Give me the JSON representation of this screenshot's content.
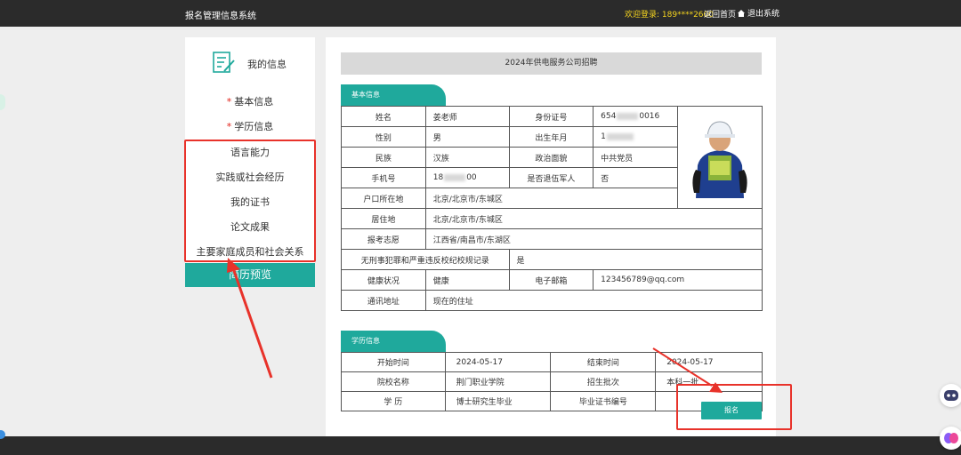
{
  "header": {
    "system_title": "报名管理信息系统",
    "welcome": "欢迎登录: 189****2600",
    "home_link": "返回首页",
    "logout": "退出系统"
  },
  "sidebar": {
    "title": "我的信息",
    "items": [
      {
        "label": "基本信息",
        "required": true
      },
      {
        "label": "学历信息",
        "required": true
      },
      {
        "label": "语言能力",
        "required": false
      },
      {
        "label": "实践或社会经历",
        "required": false
      },
      {
        "label": "我的证书",
        "required": false
      },
      {
        "label": "论文成果",
        "required": false
      },
      {
        "label": "主要家庭成员和社会关系",
        "required": false
      }
    ],
    "preview_button": "简历预览"
  },
  "main": {
    "job_title": "2024年供电服务公司招聘",
    "basic_tab": "基本信息",
    "basic": {
      "name_label": "姓名",
      "name": "姜老师",
      "id_label": "身份证号",
      "id_prefix": "654",
      "id_suffix": "0016",
      "gender_label": "性别",
      "gender": "男",
      "birth_label": "出生年月",
      "birth_prefix": "1",
      "birth_suffix": "",
      "ethnicity_label": "民族",
      "ethnicity": "汉族",
      "political_label": "政治面貌",
      "political": "中共党员",
      "phone_label": "手机号",
      "phone_prefix": "18",
      "phone_suffix": "00",
      "veteran_label": "是否退伍军人",
      "veteran": "否",
      "hukou_label": "户口所在地",
      "hukou": "北京/北京市/东城区",
      "residence_label": "居住地",
      "residence": "北京/北京市/东城区",
      "wish_label": "报考志愿",
      "wish": "江西省/南昌市/东湖区",
      "record_label": "无刑事犯罪和严重违反校纪校规记录",
      "record": "是",
      "health_label": "健康状况",
      "health": "健康",
      "email_label": "电子邮箱",
      "email": "123456789@qq.com",
      "address_label": "通讯地址",
      "address": "现在的住址"
    },
    "edu_tab": "学历信息",
    "edu": {
      "start_label": "开始时间",
      "start": "2024-05-17",
      "end_label": "结束时间",
      "end": "2024-05-17",
      "school_label": "院校名称",
      "school": "荆门职业学院",
      "batch_label": "招生批次",
      "batch": "本科一批",
      "degree_label": "学 历",
      "degree": "博士研究生毕业",
      "cert_label": "毕业证书编号",
      "cert": ""
    },
    "signup_button": "报名"
  },
  "colors": {
    "accent": "#1fa99c",
    "topbar": "#2b2b2b",
    "highlight": "#e8322a",
    "welcome": "#f5d41f"
  }
}
